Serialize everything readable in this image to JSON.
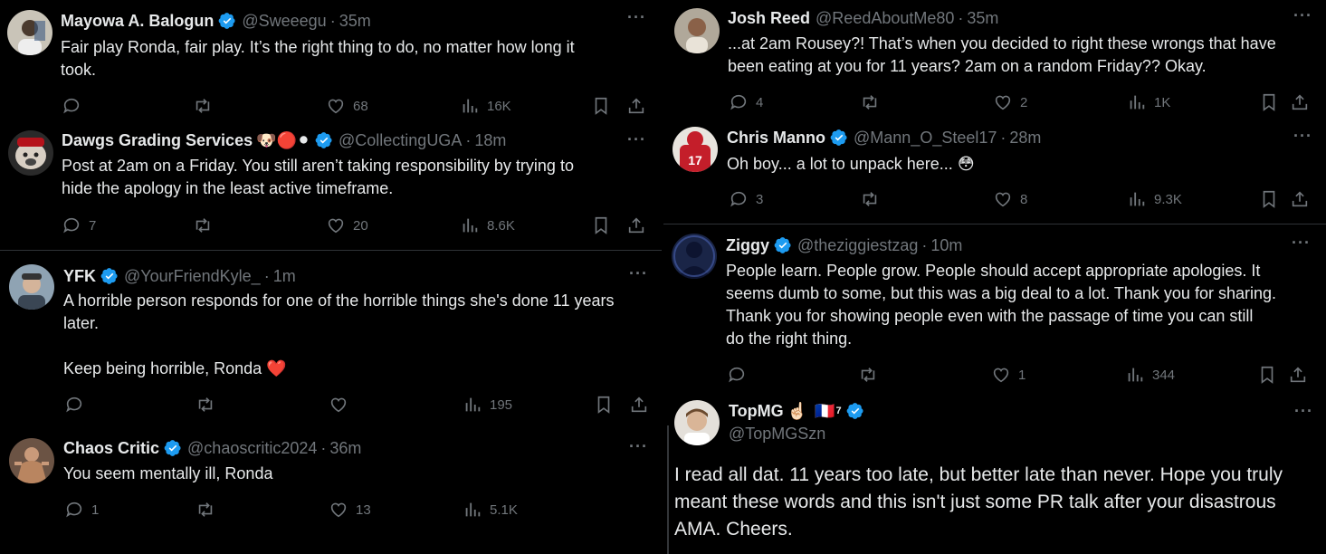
{
  "left": [
    {
      "name": "Mayowa A. Balogun",
      "verified": true,
      "handle": "@Sweeegu",
      "time": "35m",
      "lines": [
        "Fair play Ronda, fair play. It’s the right thing to do, no matter how long it",
        "took."
      ],
      "replies": "",
      "retweets": "",
      "likes": "68",
      "views": "16K",
      "avatar_color": "#c9c4b8"
    },
    {
      "name": "Dawgs Grading Services",
      "name_emoji": "🐶🔴⚫",
      "verified": true,
      "handle": "@CollectingUGA",
      "time": "18m",
      "lines": [
        "Post at 2am on a Friday. You still aren’t taking responsibility by trying to",
        "hide the apology in the least active timeframe."
      ],
      "replies": "7",
      "retweets": "",
      "likes": "20",
      "views": "8.6K",
      "avatar_color": "#8a1c1c"
    },
    {
      "name": "YFK",
      "verified": true,
      "handle": "@YourFriendKyle_",
      "time": "1m",
      "lines": [
        "A horrible person responds for one of the horrible things she's done 11 years",
        "later.",
        "",
        "Keep being horrible, Ronda ❤️"
      ],
      "replies": "",
      "retweets": "",
      "likes": "",
      "views": "195",
      "avatar_color": "#6d7a86"
    },
    {
      "name": "Chaos Critic",
      "verified": true,
      "handle": "@chaoscritic2024",
      "time": "36m",
      "lines": [
        "You seem mentally ill, Ronda"
      ],
      "replies": "1",
      "retweets": "",
      "likes": "13",
      "views": "5.1K",
      "avatar_color": "#a97b5c"
    }
  ],
  "right": [
    {
      "name": "Josh Reed",
      "verified": false,
      "handle": "@ReedAboutMe80",
      "time": "35m",
      "lines": [
        "...at 2am Rousey?! That’s when you decided to right these wrongs that have",
        "been eating at you for 11 years? 2am on a random Friday?? Okay."
      ],
      "replies": "4",
      "retweets": "",
      "likes": "2",
      "views": "1K",
      "avatar_color": "#b0a89a"
    },
    {
      "name": "Chris Manno",
      "verified": true,
      "handle": "@Mann_O_Steel17",
      "time": "28m",
      "lines": [
        "Oh boy... a lot to unpack here... 😳"
      ],
      "replies": "3",
      "retweets": "",
      "likes": "8",
      "views": "9.3K",
      "avatar_color": "#c41e2a"
    },
    {
      "name": "Ziggy",
      "verified": true,
      "handle": "@theziggiestzag",
      "time": "10m",
      "lines": [
        "People learn. People grow. People should accept appropriate apologies. It",
        "seems dumb to some, but this was a big deal to a lot. Thank you for sharing.",
        "Thank you for showing people even with the passage of time you can still",
        "do the right thing."
      ],
      "replies": "",
      "retweets": "",
      "likes": "1",
      "views": "344",
      "avatar_color": "#2b3a66"
    }
  ],
  "quoted": {
    "name": "TopMG",
    "name_emoji": "☝🏻",
    "flag": "🇫🇷",
    "flag_sup": "7",
    "verified": true,
    "handle": "@TopMGSzn",
    "lines": [
      "I read all dat. 11 years too late, but better late than never. Hope you truly",
      "meant these words and this isn't just some PR talk after your disastrous",
      "AMA. Cheers."
    ],
    "avatar_color": "#d9c8b4"
  },
  "colors": {
    "bg": "#000000",
    "text": "#e7e9ea",
    "muted": "#71767b",
    "verified": "#1d9bf0",
    "separator": "#2f3336"
  },
  "icons": [
    "more-icon",
    "reply-icon",
    "retweet-icon",
    "like-icon",
    "views-icon",
    "bookmark-icon",
    "share-icon",
    "verified-badge-icon"
  ]
}
